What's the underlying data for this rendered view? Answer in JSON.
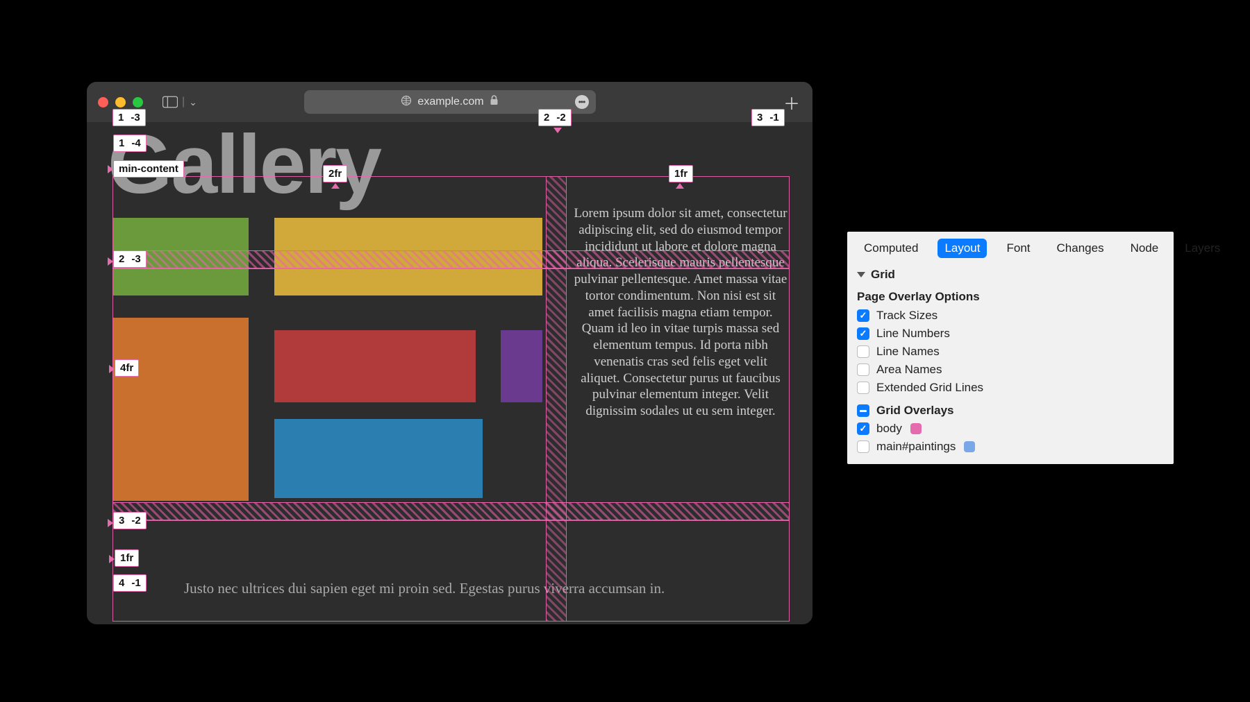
{
  "browser": {
    "url": "example.com",
    "traffic": [
      "close",
      "minimize",
      "zoom"
    ]
  },
  "page": {
    "title": "Gallery",
    "lorem": "Lorem ipsum dolor sit amet, consectetur adipiscing elit, sed do eiusmod tempor incididunt ut labore et dolore magna aliqua. Scelerisque mauris pellentesque pulvinar pellentesque. Amet massa vitae tortor condimentum. Non nisi est sit amet facilisis magna etiam tempor. Quam id leo in vitae turpis massa sed elementum tempus. Id porta nibh venenatis cras sed felis eget velit aliquet. Consectetur purus ut faucibus pulvinar elementum integer. Velit dignissim sodales ut eu sem integer.",
    "footer": "Justo nec ultrices dui sapien eget mi proin sed. Egestas purus viverra accumsan in."
  },
  "grid": {
    "col_lines": [
      {
        "pos": "1",
        "neg": "-3"
      },
      {
        "pos": "2",
        "neg": "-2"
      },
      {
        "pos": "3",
        "neg": "-1"
      }
    ],
    "row_lines": [
      {
        "pos": "1",
        "neg": "-4"
      },
      {
        "pos": "2",
        "neg": "-3"
      },
      {
        "pos": "3",
        "neg": "-2"
      },
      {
        "pos": "4",
        "neg": "-1"
      }
    ],
    "col_tracks": [
      "2fr",
      "1fr"
    ],
    "row_tracks": [
      "min-content",
      "4fr",
      "1fr"
    ]
  },
  "inspector": {
    "tabs": [
      "Computed",
      "Layout",
      "Font",
      "Changes",
      "Node",
      "Layers"
    ],
    "active_tab": "Layout",
    "grid_header": "Grid",
    "overlay_header": "Page Overlay Options",
    "options": [
      {
        "label": "Track Sizes",
        "checked": true
      },
      {
        "label": "Line Numbers",
        "checked": true
      },
      {
        "label": "Line Names",
        "checked": false
      },
      {
        "label": "Area Names",
        "checked": false
      },
      {
        "label": "Extended Grid Lines",
        "checked": false
      }
    ],
    "overlays_header": "Grid Overlays",
    "overlays_state": "mixed",
    "overlays": [
      {
        "label": "body",
        "checked": true,
        "swatch": "#e66aae"
      },
      {
        "label": "main#paintings",
        "checked": false,
        "swatch": "#7aa8e6"
      }
    ]
  }
}
